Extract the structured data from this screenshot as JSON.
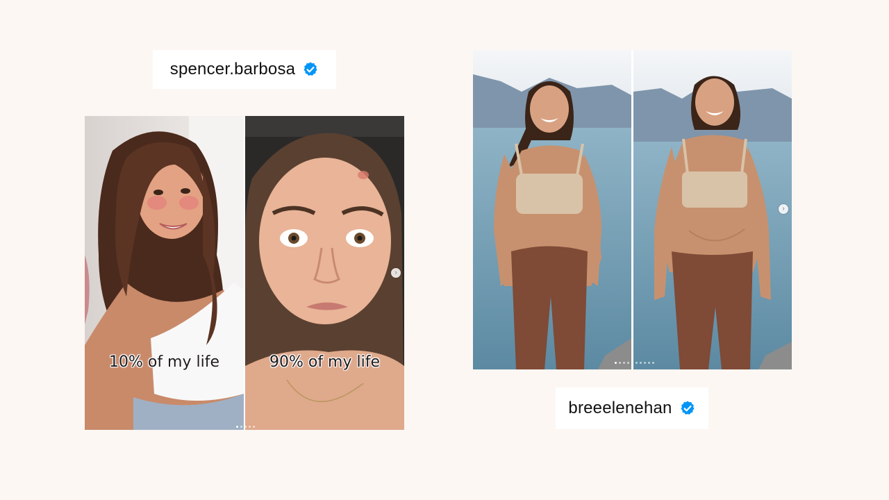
{
  "left_post": {
    "username": "spencer.barbosa",
    "verified_icon": "verified-badge-icon",
    "captions": [
      "10% of my life",
      "90% of my life"
    ],
    "carousel_dot_count": 5,
    "carousel_active_dot": 1
  },
  "right_post": {
    "username": "breeelenehan",
    "verified_icon": "verified-badge-icon",
    "carousel_dot_count": 10,
    "carousel_active_dot": 1
  },
  "colors": {
    "background": "#fcf7f3",
    "verified_blue": "#0095f6",
    "tag_background": "#ffffff"
  }
}
